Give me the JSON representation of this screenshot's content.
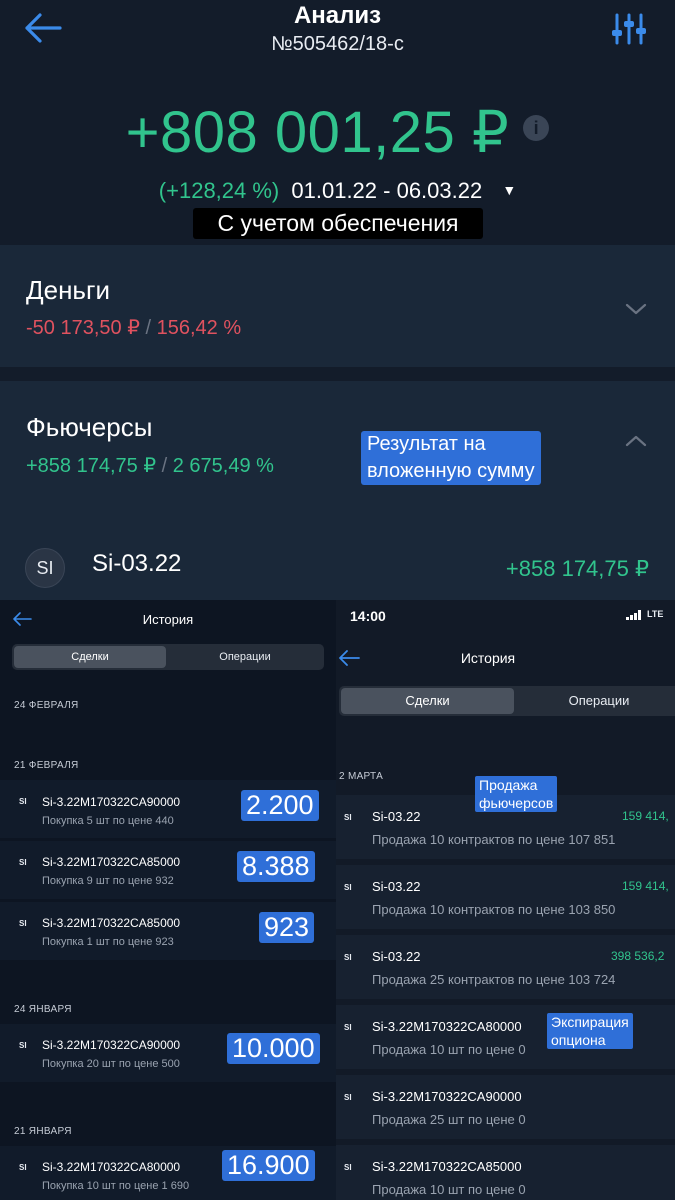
{
  "header": {
    "title": "Анализ",
    "subtitle": "№505462/18-с"
  },
  "summary": {
    "total": "+808 001,25 ₽",
    "info_glyph": "i",
    "percent": "(+128,24 %)",
    "period": "01.01.22 - 06.03.22",
    "collateral_label": "С учетом обеспечения"
  },
  "money": {
    "title": "Деньги",
    "value": "-50 173,50 ₽",
    "separator": " / ",
    "percent": "156,42 %"
  },
  "futures": {
    "title": "Фьючерсы",
    "value": "+858 174,75 ₽",
    "separator": " / ",
    "percent": "2 675,49 %",
    "annotation_line1": "Результат на",
    "annotation_line2": "вложенную сумму",
    "item_badge": "SI",
    "item_name": "Si-03.22",
    "item_value": "+858 174,75 ₽"
  },
  "left_history": {
    "title": "История",
    "tab_deals": "Сделки",
    "tab_operations": "Операции",
    "date_feb24": "24 ФЕВРАЛЯ",
    "date_feb21": "21 ФЕВРАЛЯ",
    "date_jan24": "24 ЯНВАРЯ",
    "date_jan21": "21 ЯНВАРЯ",
    "rows": [
      {
        "tag": "SI",
        "name": "Si-3.22M170322CA90000",
        "desc": "Покупка 5 шт по цене 440",
        "big": "2.200"
      },
      {
        "tag": "SI",
        "name": "Si-3.22M170322CA85000",
        "desc": "Покупка 9 шт по цене 932",
        "big": "8.388"
      },
      {
        "tag": "SI",
        "name": "Si-3.22M170322CA85000",
        "desc": "Покупка 1 шт по цене 923",
        "big": "923"
      },
      {
        "tag": "SI",
        "name": "Si-3.22M170322CA90000",
        "desc": "Покупка 20 шт по цене 500",
        "big": "10.000"
      },
      {
        "tag": "SI",
        "name": "Si-3.22M170322CA80000",
        "desc": "Покупка 10 шт по цене 1 690",
        "big": "16.900"
      }
    ]
  },
  "right_history": {
    "time": "14:00",
    "network": "LTE",
    "title": "История",
    "tab_deals": "Сделки",
    "tab_operations": "Операции",
    "date_mar2": "2 МАРТА",
    "annotation_sell_line1": "Продажа",
    "annotation_sell_line2": "фьючерсов",
    "annotation_exp_line1": "Экспирация",
    "annotation_exp_line2": "опциона",
    "rows": [
      {
        "tag": "SI",
        "name": "Si-03.22",
        "desc": "Продажа 10 контрактов по цене 107 851",
        "value": "159 414,"
      },
      {
        "tag": "SI",
        "name": "Si-03.22",
        "desc": "Продажа 10 контрактов по цене 103 850",
        "value": "159 414,"
      },
      {
        "tag": "SI",
        "name": "Si-03.22",
        "desc": "Продажа 25 контрактов по цене 103 724",
        "value": "398 536,2"
      },
      {
        "tag": "SI",
        "name": "Si-3.22M170322CA80000",
        "desc": "Продажа 10 шт по цене 0",
        "value": ""
      },
      {
        "tag": "SI",
        "name": "Si-3.22M170322CA90000",
        "desc": "Продажа 25 шт по цене 0",
        "value": ""
      },
      {
        "tag": "SI",
        "name": "Si-3.22M170322CA85000",
        "desc": "Продажа 10 шт по цене 0",
        "value": ""
      }
    ]
  },
  "icons": {
    "back": "arrow-left-icon",
    "filter": "sliders-icon",
    "info": "info-icon",
    "caret": "caret-down-icon",
    "expand": "chevron-down-icon",
    "collapse": "chevron-up-icon",
    "signal": "signal-bars-icon"
  },
  "colors": {
    "positive": "#31c48d",
    "negative": "#e0525f",
    "accent": "#3b8bea",
    "annotation": "#2f6fd8"
  }
}
